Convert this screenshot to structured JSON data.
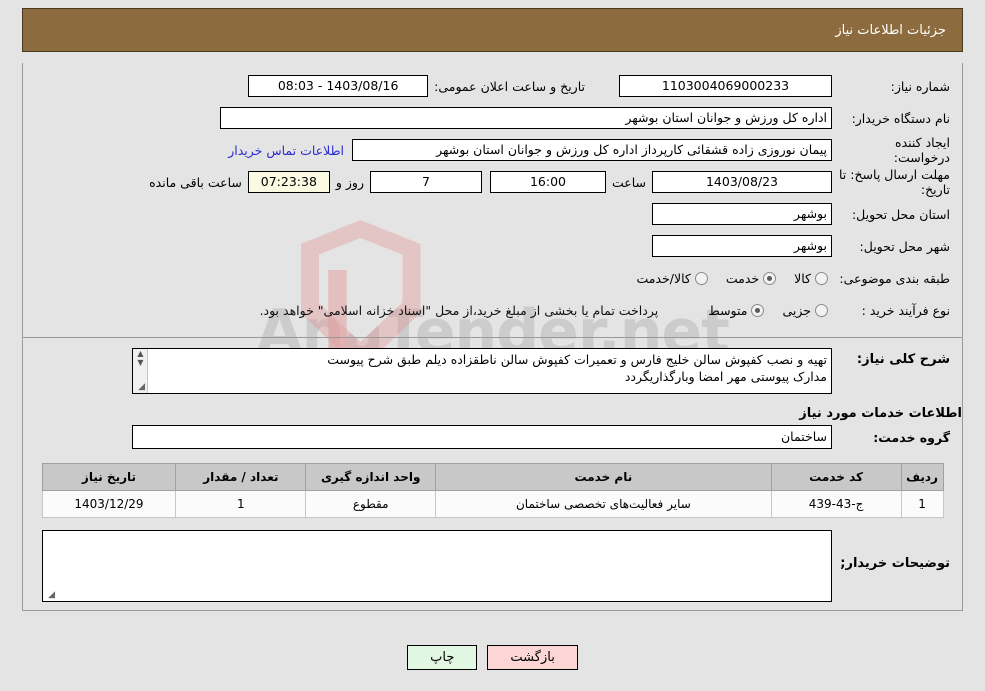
{
  "header": {
    "title": "جزئیات اطلاعات نیاز"
  },
  "fields": {
    "need_number_label": "شماره نیاز:",
    "need_number_value": "1103004069000233",
    "announce_datetime_label": "تاریخ و ساعت اعلان عمومی:",
    "announce_datetime_value": "1403/08/16 - 08:03",
    "buyer_org_label": "نام دستگاه خریدار:",
    "buyer_org_value": "اداره کل ورزش و جوانان استان بوشهر",
    "requester_label": "ایجاد کننده درخواست:",
    "requester_value": "پیمان نوروزی زاده قشقائی کارپرداز اداره کل ورزش و جوانان استان بوشهر",
    "contact_link": "اطلاعات تماس خریدار",
    "deadline_label": "مهلت ارسال پاسخ: تا تاریخ:",
    "deadline_date": "1403/08/23",
    "hour_label": "ساعت",
    "hour_value": "16:00",
    "days_value": "7",
    "days_label": "روز و",
    "countdown_value": "07:23:38",
    "remaining_label": "ساعت باقی مانده",
    "province_label": "استان محل تحویل:",
    "province_value": "بوشهر",
    "city_label": "شهر محل تحویل:",
    "city_value": "بوشهر",
    "category_label": "طبقه بندی موضوعی:",
    "process_label": "نوع فرآیند خرید :",
    "payment_note": "پرداخت تمام یا بخشی از مبلغ خرید،از محل \"اسناد خزانه اسلامی\" خواهد بود."
  },
  "category_options": [
    {
      "label": "کالا",
      "selected": false
    },
    {
      "label": "خدمت",
      "selected": true
    },
    {
      "label": "کالا/خدمت",
      "selected": false
    }
  ],
  "process_options": [
    {
      "label": "جزیی",
      "selected": false
    },
    {
      "label": "متوسط",
      "selected": true
    }
  ],
  "description": {
    "label": "شرح کلی نیاز:",
    "value": "تهیه و نصب کفپوش سالن خلیج فارس و تعمیرات کفپوش سالن ناطقزاده دیلم طبق شرح پیوست\nمدارک پیوستی مهر امضا وبارگذاریگردد"
  },
  "services_section": {
    "heading": "اطلاعات خدمات مورد نیاز",
    "service_group_label": "گروه خدمت:",
    "service_group_value": "ساختمان"
  },
  "table": {
    "headers": [
      "ردیف",
      "کد خدمت",
      "نام خدمت",
      "واحد اندازه گیری",
      "تعداد / مقدار",
      "تاریخ نیاز"
    ],
    "rows": [
      {
        "row_no": "1",
        "service_code": "ج-43-439",
        "service_name": "سایر فعالیت‌های تخصصی ساختمان",
        "unit": "مقطوع",
        "quantity": "1",
        "need_date": "1403/12/29"
      }
    ]
  },
  "buyer_notes": {
    "label": "توضیحات خریدار;",
    "value": ""
  },
  "footer": {
    "back_label": "بازگشت",
    "print_label": "چاپ"
  },
  "watermark": {
    "text": "AnaTender.net"
  },
  "colors": {
    "header_bg": "#8c6c3f",
    "link": "#2b2bd1",
    "countdown_bg": "#fbfbe3",
    "back_btn": "#fcd5d5",
    "print_btn": "#e2f7e2"
  }
}
